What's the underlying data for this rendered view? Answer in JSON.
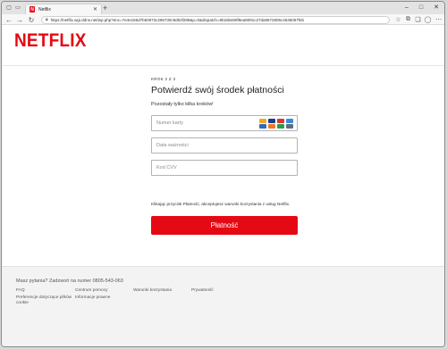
{
  "browser": {
    "tab_title": "Netflix",
    "tab_favicon": "N",
    "url": "https://netflix.wgi.ddns.net/wp.php?enc=7e4e155d7b50973c296730c9d52f289&p=0&dispatch=9b2d6469f9ea8091c27da9672805c4635067feb"
  },
  "brand": {
    "logo": "NETFLIX",
    "accent": "#e50914"
  },
  "form": {
    "step": "KROK 2 Z 3",
    "title": "Potwierdź swój środek płatności",
    "subtitle": "Pozostały tylko kilka kroków!",
    "card_placeholder": "Numer karty",
    "expiry_placeholder": "Data ważności",
    "cvv_placeholder": "Kod CVV",
    "consent": "Klikając przycisk Płatność, akceptujesz warunki korzystania z usług Netflix.",
    "pay_button": "Płatność"
  },
  "card_icons": [
    {
      "name": "mastercard-icon",
      "color": "#f6a623"
    },
    {
      "name": "visa-icon",
      "color": "#1a3d8f"
    },
    {
      "name": "maestro-icon",
      "color": "#d6372f"
    },
    {
      "name": "amex-icon",
      "color": "#3c8bd9"
    },
    {
      "name": "diners-icon",
      "color": "#2e6bb8"
    },
    {
      "name": "discover-icon",
      "color": "#f07a21"
    },
    {
      "name": "jcb-icon",
      "color": "#2c9a4c"
    },
    {
      "name": "unionpay-icon",
      "color": "#5a6e8a"
    }
  ],
  "footer": {
    "question": "Masz pytania? Zadzwoń na numer 0805-543-063",
    "links": {
      "faq": "FAQ",
      "help_center": "Centrum pomocy",
      "terms": "Warunki korzystania",
      "privacy": "Prywatność",
      "cookies": "Preferencje dotyczące plików cookie",
      "legal": "Informacje prawne"
    }
  }
}
